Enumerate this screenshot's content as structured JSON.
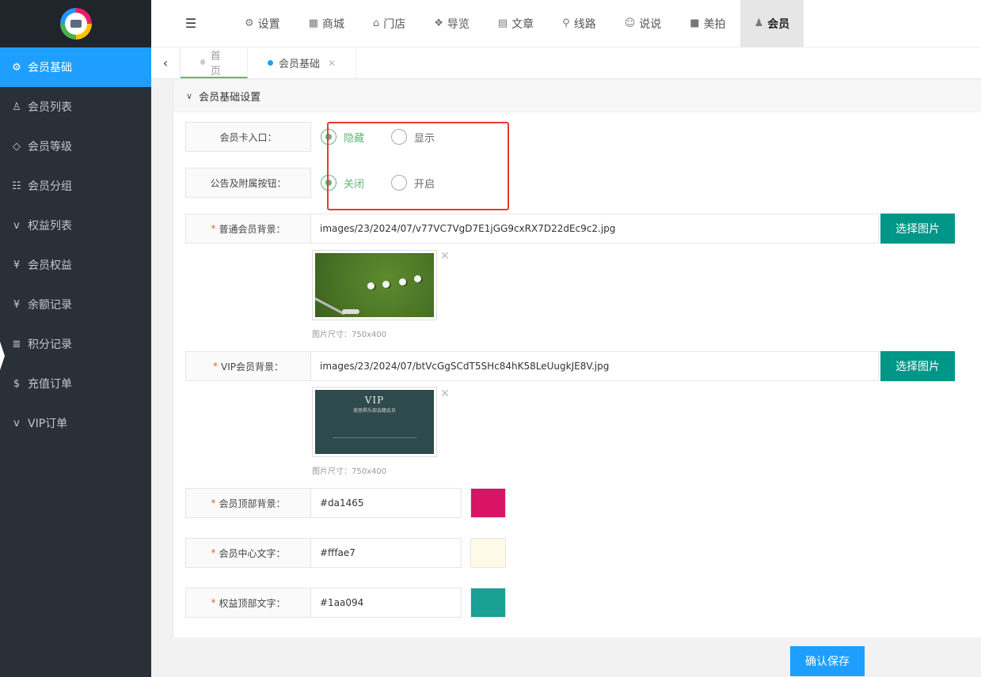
{
  "sidebar": {
    "items": [
      {
        "icon": "gears-icon",
        "glyph": "⚙",
        "label": "会员基础"
      },
      {
        "icon": "user-icon",
        "glyph": "♙",
        "label": "会员列表"
      },
      {
        "icon": "diamond-icon",
        "glyph": "◇",
        "label": "会员等级"
      },
      {
        "icon": "users-icon",
        "glyph": "☷",
        "label": "会员分组"
      },
      {
        "icon": "vimeo-icon",
        "glyph": "v",
        "label": "权益列表"
      },
      {
        "icon": "yen-icon",
        "glyph": "¥",
        "label": "会员权益"
      },
      {
        "icon": "yen-icon",
        "glyph": "¥",
        "label": "余额记录"
      },
      {
        "icon": "database-icon",
        "glyph": "≣",
        "label": "积分记录"
      },
      {
        "icon": "dollar-icon",
        "glyph": "$",
        "label": "充值订单"
      },
      {
        "icon": "vimeo-icon",
        "glyph": "v",
        "label": "VIP订单"
      }
    ]
  },
  "topnav": {
    "items": [
      {
        "icon": "cogs-icon",
        "glyph": "⚙",
        "label": "设置"
      },
      {
        "icon": "shop-icon",
        "glyph": "▦",
        "label": "商城"
      },
      {
        "icon": "bank-icon",
        "glyph": "⌂",
        "label": "门店"
      },
      {
        "icon": "cubes-icon",
        "glyph": "❖",
        "label": "导览"
      },
      {
        "icon": "newspaper-icon",
        "glyph": "▤",
        "label": "文章"
      },
      {
        "icon": "route-icon",
        "glyph": "⚲",
        "label": "线路"
      },
      {
        "icon": "wechat-icon",
        "glyph": "☺",
        "label": "说说"
      },
      {
        "icon": "video-icon",
        "glyph": "■",
        "label": "美拍"
      },
      {
        "icon": "user-secret-icon",
        "glyph": "♟",
        "label": "会员"
      }
    ]
  },
  "tabs": {
    "home": "首页",
    "current": "会员基础"
  },
  "panel": {
    "title": "会员基础设置"
  },
  "form": {
    "card_entry": {
      "label": "会员卡入口：",
      "options": [
        "隐藏",
        "显示"
      ]
    },
    "notice_button": {
      "label": "公告及附属按钮：",
      "options": [
        "关闭",
        "开启"
      ]
    },
    "normal_bg": {
      "label": "普通会员背景：",
      "value": "images/23/2024/07/v77VC7VgD7E1jGG9cxRX7D22dEc9c2.jpg",
      "size_note": "图片尺寸：750x400"
    },
    "vip_bg": {
      "label": "VIP会员背景：",
      "value": "images/23/2024/07/btVcGgSCdT5SHc84hK58LeUugkJE8V.jpg",
      "size_note": "图片尺寸：750x400"
    },
    "choose_image": "选择图片",
    "top_bg": {
      "label": "会员顶部背景：",
      "value": "#da1465"
    },
    "center_text": {
      "label": "会员中心文字：",
      "value": "#fffae7"
    },
    "rights_text": {
      "label": "权益顶部文字：",
      "value": "#1aa094"
    },
    "vip_card": {
      "title": "VIP",
      "subtitle": "美丽俱乐部会籍会员"
    }
  },
  "save_button": "确认保存",
  "colors": {
    "accent": "#1e9fff",
    "green": "#5fb878",
    "teal_button": "#009688",
    "highlight_box": "#e53935"
  }
}
